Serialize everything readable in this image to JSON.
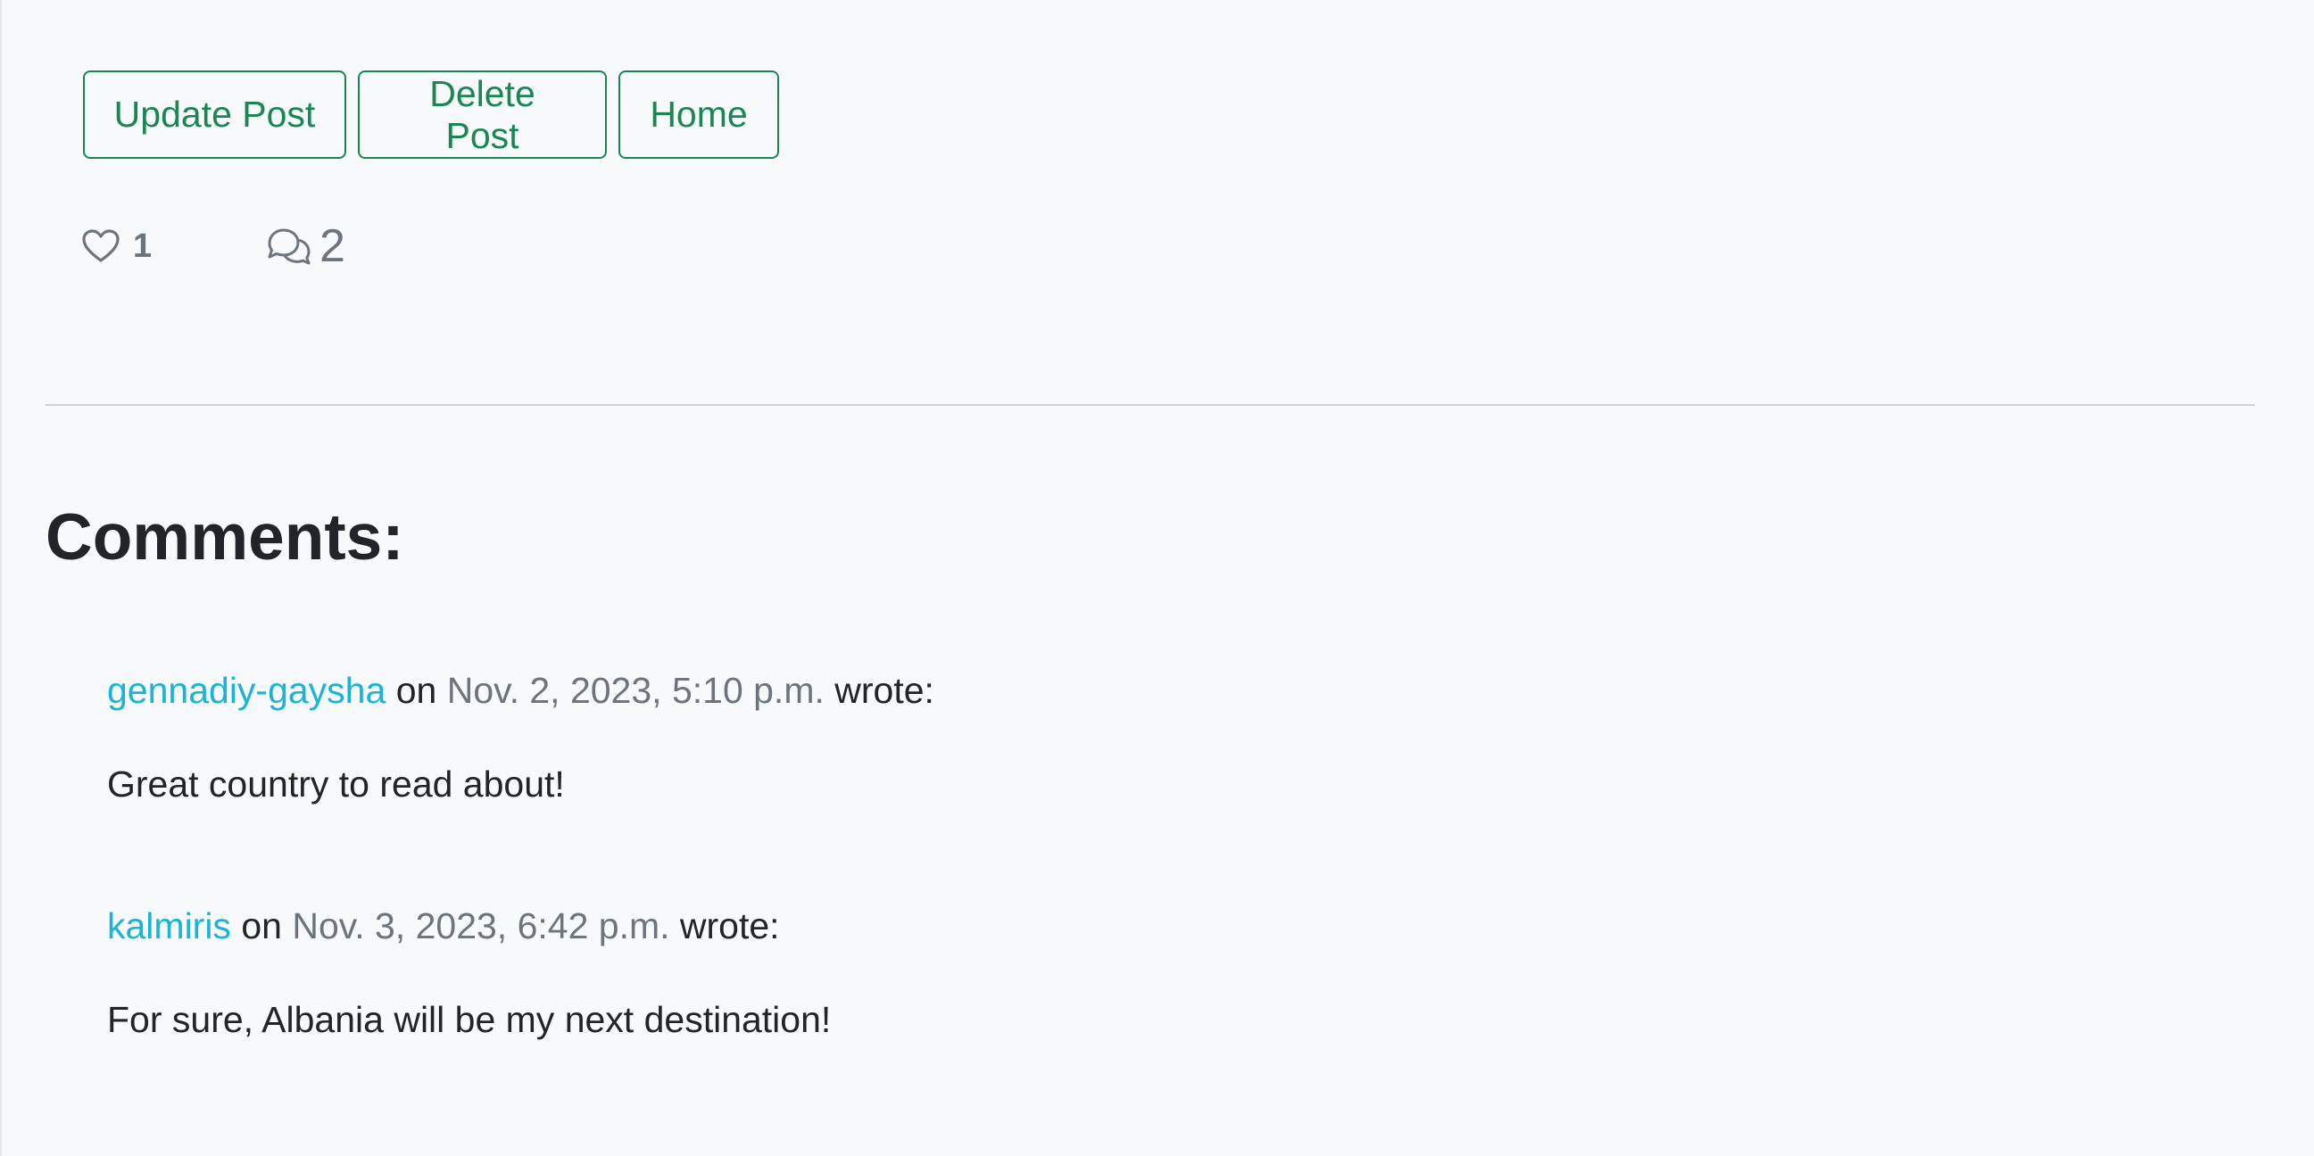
{
  "actions": {
    "update_label": "Update Post",
    "delete_label": "Delete Post",
    "home_label": "Home"
  },
  "stats": {
    "likes_count": "1",
    "comments_count": "2",
    "like_icon": "heart-icon",
    "comment_icon": "chat-bubbles-icon"
  },
  "comments": {
    "title": "Comments:",
    "on_word": "on",
    "wrote_word": "wrote:",
    "items": [
      {
        "author": "gennadiy-gaysha",
        "date": "Nov. 2, 2023, 5:10 p.m.",
        "text": "Great country to read about!"
      },
      {
        "author": "kalmiris",
        "date": "Nov. 3, 2023, 6:42 p.m.",
        "text": "For sure, Albania will be my next destination!"
      }
    ]
  },
  "colors": {
    "accent_green": "#198754",
    "link_cyan": "#19b4d6",
    "muted_gray": "#6c757d",
    "background": "#f8f9fb"
  }
}
